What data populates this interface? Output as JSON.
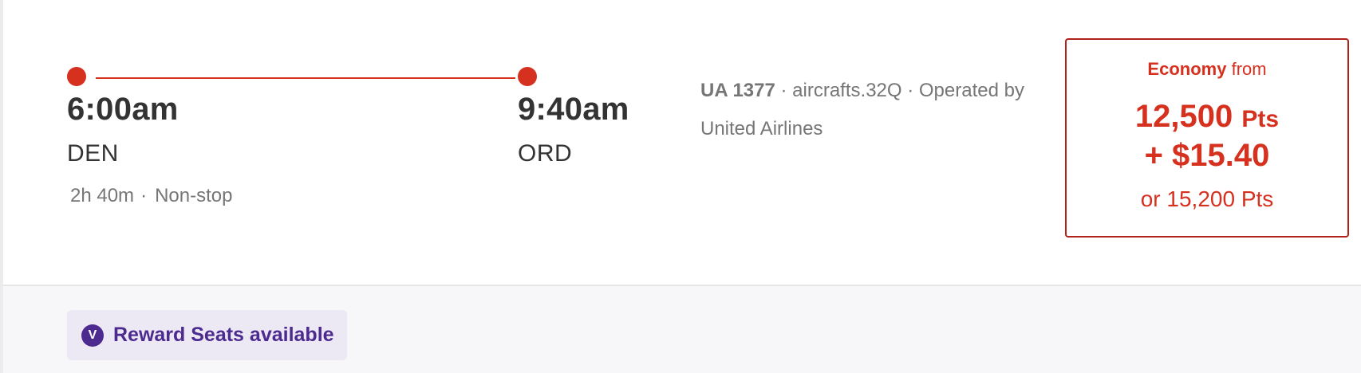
{
  "flight": {
    "departure": {
      "time": "6:00am",
      "airport": "DEN"
    },
    "arrival": {
      "time": "9:40am",
      "airport": "ORD"
    },
    "duration": "2h 40m",
    "separator": "·",
    "stops": "Non-stop",
    "flight_number": "UA 1377",
    "details": " · aircrafts.32Q · Operated by United Airlines"
  },
  "fare": {
    "cabin": "Economy",
    "from_label": "from",
    "points": "12,500",
    "points_unit": "Pts",
    "cash": "+ $15.40",
    "alt": "or 15,200 Pts"
  },
  "reward_badge": {
    "icon_letter": "V",
    "label": "Reward Seats available"
  },
  "colors": {
    "accent_red": "#d6301f",
    "reward_purple": "#4c2a8f"
  }
}
